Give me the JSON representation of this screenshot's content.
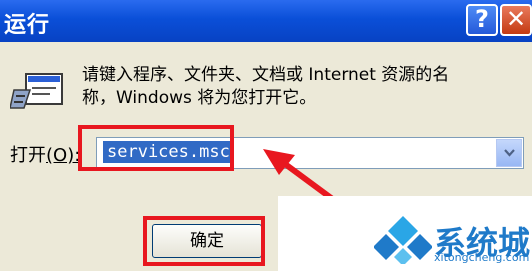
{
  "window": {
    "title": "运行",
    "help_glyph": "?",
    "close_glyph": "✕"
  },
  "dialog": {
    "description_line1": "请键入程序、文件夹、文档或 Internet 资源的名",
    "description_line2": "称，Windows 将为您打开它。",
    "open_label": "打开",
    "open_hotkey": "(O):",
    "input_value": "services.msc",
    "ok_label": "确定"
  },
  "annotations": {
    "highlight_color": "#e8171f"
  },
  "watermark": {
    "name": "系统城",
    "url": "xitongcheng.com",
    "color": "#1f7ac9"
  },
  "icons": [
    "run-program-icon",
    "dropdown-chevron-icon",
    "help-icon",
    "close-icon",
    "arrow-icon",
    "windows-logo-icon"
  ]
}
